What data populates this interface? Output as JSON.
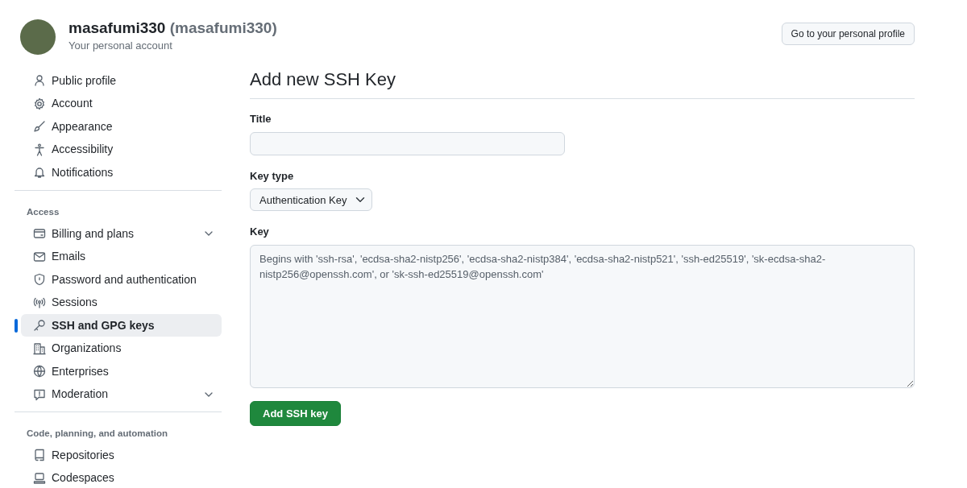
{
  "account": {
    "name": "masafumi330",
    "handle": "(masafumi330)",
    "subtitle": "Your personal account"
  },
  "profile_button": "Go to your personal profile",
  "sidebar": {
    "groups": [
      {
        "items": [
          {
            "label": "Public profile",
            "selected": false,
            "submenu": false
          },
          {
            "label": "Account",
            "selected": false,
            "submenu": false
          },
          {
            "label": "Appearance",
            "selected": false,
            "submenu": false
          },
          {
            "label": "Accessibility",
            "selected": false,
            "submenu": false
          },
          {
            "label": "Notifications",
            "selected": false,
            "submenu": false
          }
        ]
      },
      {
        "heading": "Access",
        "items": [
          {
            "label": "Billing and plans",
            "selected": false,
            "submenu": true
          },
          {
            "label": "Emails",
            "selected": false,
            "submenu": false
          },
          {
            "label": "Password and authentication",
            "selected": false,
            "submenu": false
          },
          {
            "label": "Sessions",
            "selected": false,
            "submenu": false
          },
          {
            "label": "SSH and GPG keys",
            "selected": true,
            "submenu": false
          },
          {
            "label": "Organizations",
            "selected": false,
            "submenu": false
          },
          {
            "label": "Enterprises",
            "selected": false,
            "submenu": false
          },
          {
            "label": "Moderation",
            "selected": false,
            "submenu": true
          }
        ]
      },
      {
        "heading": "Code, planning, and automation",
        "items": [
          {
            "label": "Repositories",
            "selected": false,
            "submenu": false
          },
          {
            "label": "Codespaces",
            "selected": false,
            "submenu": false
          }
        ]
      }
    ]
  },
  "form": {
    "title": "Add new SSH Key",
    "title_field": {
      "label": "Title"
    },
    "key_type": {
      "label": "Key type",
      "value": "Authentication Key"
    },
    "key": {
      "label": "Key",
      "placeholder": "Begins with 'ssh-rsa', 'ecdsa-sha2-nistp256', 'ecdsa-sha2-nistp384', 'ecdsa-sha2-nistp521', 'ssh-ed25519', 'sk-ecdsa-sha2-nistp256@openssh.com', or 'sk-ssh-ed25519@openssh.com'"
    },
    "submit": "Add SSH key"
  }
}
